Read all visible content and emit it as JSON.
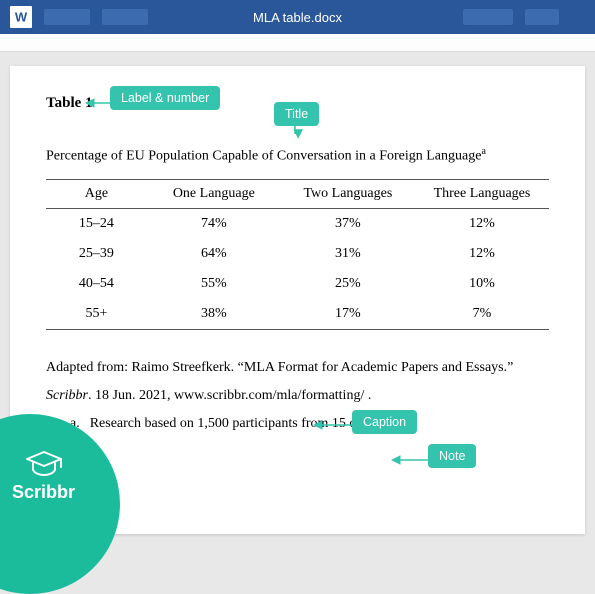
{
  "app": {
    "word_icon": "W",
    "doc_title": "MLA table.docx"
  },
  "document": {
    "table_label": "Table 1",
    "table_title": "Percentage of EU Population Capable of Conversation in a Foreign Language",
    "table_title_marker": "a",
    "headers": [
      "Age",
      "One Language",
      "Two Languages",
      "Three Languages"
    ],
    "rows": [
      {
        "age": "15–24",
        "one": "74%",
        "two": "37%",
        "three": "12%"
      },
      {
        "age": "25–39",
        "one": "64%",
        "two": "31%",
        "three": "12%"
      },
      {
        "age": "40–54",
        "one": "55%",
        "two": "25%",
        "three": "10%"
      },
      {
        "age": "55+",
        "one": "38%",
        "two": "17%",
        "three": "7%"
      }
    ],
    "caption_pre": "Adapted from: Raimo Streefkerk. “MLA Format for Academic Papers and Essays.” ",
    "caption_italic": "Scribbr",
    "caption_post": ". 18 Jun. 2021, www.scribbr.com/mla/formatting/ .",
    "note_marker": "a.",
    "note_text": "Research based on 1,500 participants from 15 countries."
  },
  "annotations": {
    "label_number": "Label & number",
    "title": "Title",
    "caption": "Caption",
    "note": "Note"
  },
  "brand": {
    "name": "Scribbr"
  },
  "colors": {
    "word_blue": "#2a579a",
    "accent_teal": "#34c3ac",
    "scribbr_teal": "#1abc9c"
  }
}
